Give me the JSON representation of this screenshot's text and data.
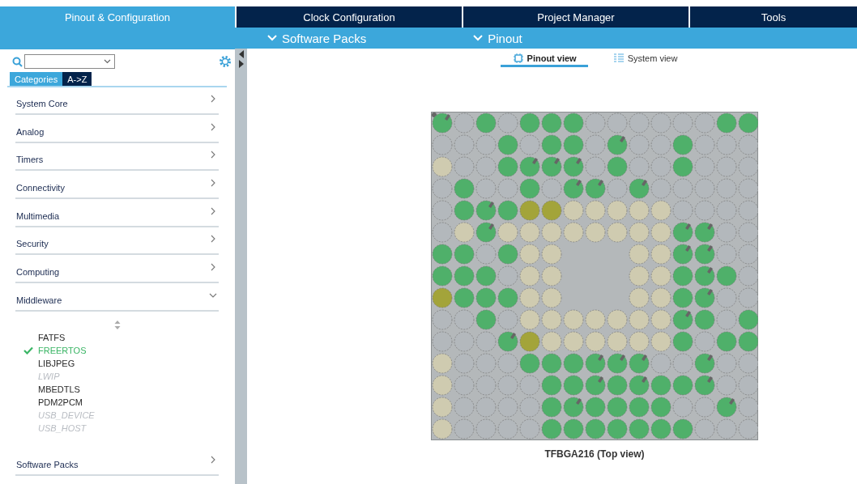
{
  "top_tabs": [
    {
      "label": "Pinout & Configuration",
      "selected": true
    },
    {
      "label": "Clock Configuration",
      "selected": false
    },
    {
      "label": "Project Manager",
      "selected": false
    },
    {
      "label": "Tools",
      "selected": false
    }
  ],
  "sub_menus": [
    "Software Packs",
    "Pinout"
  ],
  "sidebar": {
    "mode_tabs": [
      {
        "label": "Categories",
        "selected": true
      },
      {
        "label": "A->Z",
        "selected": false
      }
    ],
    "categories": [
      {
        "label": "System Core",
        "expanded": false
      },
      {
        "label": "Analog",
        "expanded": false
      },
      {
        "label": "Timers",
        "expanded": false
      },
      {
        "label": "Connectivity",
        "expanded": false
      },
      {
        "label": "Multimedia",
        "expanded": false
      },
      {
        "label": "Security",
        "expanded": false
      },
      {
        "label": "Computing",
        "expanded": false
      },
      {
        "label": "Middleware",
        "expanded": true,
        "children": [
          {
            "label": "FATFS",
            "checked": false,
            "disabled": false
          },
          {
            "label": "FREERTOS",
            "checked": true,
            "disabled": false
          },
          {
            "label": "LIBJPEG",
            "checked": false,
            "disabled": false
          },
          {
            "label": "LWIP",
            "checked": false,
            "disabled": true
          },
          {
            "label": "MBEDTLS",
            "checked": false,
            "disabled": false
          },
          {
            "label": "PDM2PCM",
            "checked": false,
            "disabled": false
          },
          {
            "label": "USB_DEVICE",
            "checked": false,
            "disabled": true
          },
          {
            "label": "USB_HOST",
            "checked": false,
            "disabled": true
          }
        ]
      },
      {
        "label": "Software Packs",
        "expanded": false
      }
    ]
  },
  "view_tabs": [
    {
      "label": "Pinout view",
      "selected": true,
      "kind": "chip"
    },
    {
      "label": "System view",
      "selected": false,
      "kind": "list"
    }
  ],
  "package": {
    "caption": "TFBGA216 (Top view)",
    "rows": [
      [
        {
          "kind": "pin"
        },
        {
          "kind": "io"
        },
        {
          "kind": "set"
        },
        {
          "kind": "io"
        },
        {
          "kind": "set"
        },
        {
          "kind": "set"
        },
        {
          "kind": "set"
        },
        {
          "kind": "io"
        },
        {
          "kind": "io"
        },
        {
          "kind": "io"
        },
        {
          "kind": "io"
        },
        {
          "kind": "io"
        },
        {
          "kind": "io"
        },
        {
          "kind": "set"
        },
        {
          "kind": "set"
        }
      ],
      [
        {
          "kind": "io"
        },
        {
          "kind": "io"
        },
        {
          "kind": "io"
        },
        {
          "kind": "set"
        },
        {
          "kind": "io"
        },
        {
          "kind": "set"
        },
        {
          "kind": "set"
        },
        {
          "kind": "io"
        },
        {
          "kind": "pin"
        },
        {
          "kind": "io"
        },
        {
          "kind": "io"
        },
        {
          "kind": "set"
        },
        {
          "kind": "io"
        },
        {
          "kind": "io"
        },
        {
          "kind": "io"
        }
      ],
      [
        {
          "kind": "pwr"
        },
        {
          "kind": "io"
        },
        {
          "kind": "io"
        },
        {
          "kind": "set"
        },
        {
          "kind": "pin"
        },
        {
          "kind": "pin"
        },
        {
          "kind": "pin"
        },
        {
          "kind": "io"
        },
        {
          "kind": "set"
        },
        {
          "kind": "io"
        },
        {
          "kind": "io"
        },
        {
          "kind": "set"
        },
        {
          "kind": "io"
        },
        {
          "kind": "io"
        },
        {
          "kind": "io"
        }
      ],
      [
        {
          "kind": "io"
        },
        {
          "kind": "set"
        },
        {
          "kind": "io"
        },
        {
          "kind": "io"
        },
        {
          "kind": "set"
        },
        {
          "kind": "io"
        },
        {
          "kind": "pin"
        },
        {
          "kind": "pin"
        },
        {
          "kind": "io"
        },
        {
          "kind": "pin"
        },
        {
          "kind": "io"
        },
        {
          "kind": "io"
        },
        {
          "kind": "io"
        },
        {
          "kind": "io"
        },
        {
          "kind": "io"
        }
      ],
      [
        {
          "kind": "io"
        },
        {
          "kind": "set"
        },
        {
          "kind": "pin"
        },
        {
          "kind": "set"
        },
        {
          "kind": "sys"
        },
        {
          "kind": "sys"
        },
        {
          "kind": "pwr"
        },
        {
          "kind": "pwr"
        },
        {
          "kind": "pwr"
        },
        {
          "kind": "pwr"
        },
        {
          "kind": "pwr"
        },
        {
          "kind": "io"
        },
        {
          "kind": "io"
        },
        {
          "kind": "io"
        },
        {
          "kind": "io"
        }
      ],
      [
        {
          "kind": "io"
        },
        {
          "kind": "pwr"
        },
        {
          "kind": "pin"
        },
        {
          "kind": "pwr"
        },
        {
          "kind": "pwr"
        },
        {
          "kind": "pwr"
        },
        {
          "kind": "pwr"
        },
        {
          "kind": "pwr"
        },
        {
          "kind": "pwr"
        },
        {
          "kind": "pwr"
        },
        {
          "kind": "pwr"
        },
        {
          "kind": "pin"
        },
        {
          "kind": "pin"
        },
        {
          "kind": "io"
        },
        {
          "kind": "io"
        }
      ],
      [
        {
          "kind": "set"
        },
        {
          "kind": "set"
        },
        {
          "kind": "io"
        },
        {
          "kind": "set"
        },
        {
          "kind": "pwr"
        },
        {
          "kind": "pwr"
        },
        {
          "kind": "gap"
        },
        {
          "kind": "gap"
        },
        {
          "kind": "gap"
        },
        {
          "kind": "pwr"
        },
        {
          "kind": "pwr"
        },
        {
          "kind": "pin"
        },
        {
          "kind": "pin"
        },
        {
          "kind": "io"
        },
        {
          "kind": "io"
        }
      ],
      [
        {
          "kind": "set"
        },
        {
          "kind": "set"
        },
        {
          "kind": "set"
        },
        {
          "kind": "io"
        },
        {
          "kind": "pwr"
        },
        {
          "kind": "pwr"
        },
        {
          "kind": "gap"
        },
        {
          "kind": "gap"
        },
        {
          "kind": "gap"
        },
        {
          "kind": "pwr"
        },
        {
          "kind": "pwr"
        },
        {
          "kind": "set"
        },
        {
          "kind": "pin"
        },
        {
          "kind": "set"
        },
        {
          "kind": "io"
        }
      ],
      [
        {
          "kind": "sys"
        },
        {
          "kind": "set"
        },
        {
          "kind": "set"
        },
        {
          "kind": "set"
        },
        {
          "kind": "pwr"
        },
        {
          "kind": "pwr"
        },
        {
          "kind": "gap"
        },
        {
          "kind": "gap"
        },
        {
          "kind": "gap"
        },
        {
          "kind": "pwr"
        },
        {
          "kind": "pwr"
        },
        {
          "kind": "set"
        },
        {
          "kind": "pin"
        },
        {
          "kind": "io"
        },
        {
          "kind": "io"
        }
      ],
      [
        {
          "kind": "io"
        },
        {
          "kind": "io"
        },
        {
          "kind": "set"
        },
        {
          "kind": "io"
        },
        {
          "kind": "pwr"
        },
        {
          "kind": "pwr"
        },
        {
          "kind": "pwr"
        },
        {
          "kind": "pwr"
        },
        {
          "kind": "pwr"
        },
        {
          "kind": "pwr"
        },
        {
          "kind": "pwr"
        },
        {
          "kind": "pin"
        },
        {
          "kind": "set"
        },
        {
          "kind": "io"
        },
        {
          "kind": "set"
        }
      ],
      [
        {
          "kind": "io"
        },
        {
          "kind": "io"
        },
        {
          "kind": "io"
        },
        {
          "kind": "pin"
        },
        {
          "kind": "sys"
        },
        {
          "kind": "pwr"
        },
        {
          "kind": "pwr"
        },
        {
          "kind": "pwr"
        },
        {
          "kind": "pwr"
        },
        {
          "kind": "pwr"
        },
        {
          "kind": "pwr"
        },
        {
          "kind": "set"
        },
        {
          "kind": "io"
        },
        {
          "kind": "set"
        },
        {
          "kind": "set"
        }
      ],
      [
        {
          "kind": "pwr"
        },
        {
          "kind": "io"
        },
        {
          "kind": "io"
        },
        {
          "kind": "io"
        },
        {
          "kind": "set"
        },
        {
          "kind": "set"
        },
        {
          "kind": "set"
        },
        {
          "kind": "pin"
        },
        {
          "kind": "pin"
        },
        {
          "kind": "pin"
        },
        {
          "kind": "io"
        },
        {
          "kind": "io"
        },
        {
          "kind": "pin"
        },
        {
          "kind": "io"
        },
        {
          "kind": "io"
        }
      ],
      [
        {
          "kind": "pwr"
        },
        {
          "kind": "io"
        },
        {
          "kind": "io"
        },
        {
          "kind": "io"
        },
        {
          "kind": "io"
        },
        {
          "kind": "set"
        },
        {
          "kind": "set"
        },
        {
          "kind": "pin"
        },
        {
          "kind": "set"
        },
        {
          "kind": "pin"
        },
        {
          "kind": "set"
        },
        {
          "kind": "set"
        },
        {
          "kind": "pin"
        },
        {
          "kind": "io"
        },
        {
          "kind": "io"
        }
      ],
      [
        {
          "kind": "pwr"
        },
        {
          "kind": "io"
        },
        {
          "kind": "io"
        },
        {
          "kind": "io"
        },
        {
          "kind": "io"
        },
        {
          "kind": "set"
        },
        {
          "kind": "pin"
        },
        {
          "kind": "set"
        },
        {
          "kind": "set"
        },
        {
          "kind": "set"
        },
        {
          "kind": "set"
        },
        {
          "kind": "io"
        },
        {
          "kind": "io"
        },
        {
          "kind": "pin"
        },
        {
          "kind": "io"
        }
      ],
      [
        {
          "kind": "pwr"
        },
        {
          "kind": "io"
        },
        {
          "kind": "io"
        },
        {
          "kind": "io"
        },
        {
          "kind": "io"
        },
        {
          "kind": "set"
        },
        {
          "kind": "set"
        },
        {
          "kind": "set"
        },
        {
          "kind": "set"
        },
        {
          "kind": "set"
        },
        {
          "kind": "set"
        },
        {
          "kind": "set"
        },
        {
          "kind": "io"
        },
        {
          "kind": "io"
        },
        {
          "kind": "io"
        }
      ]
    ]
  }
}
